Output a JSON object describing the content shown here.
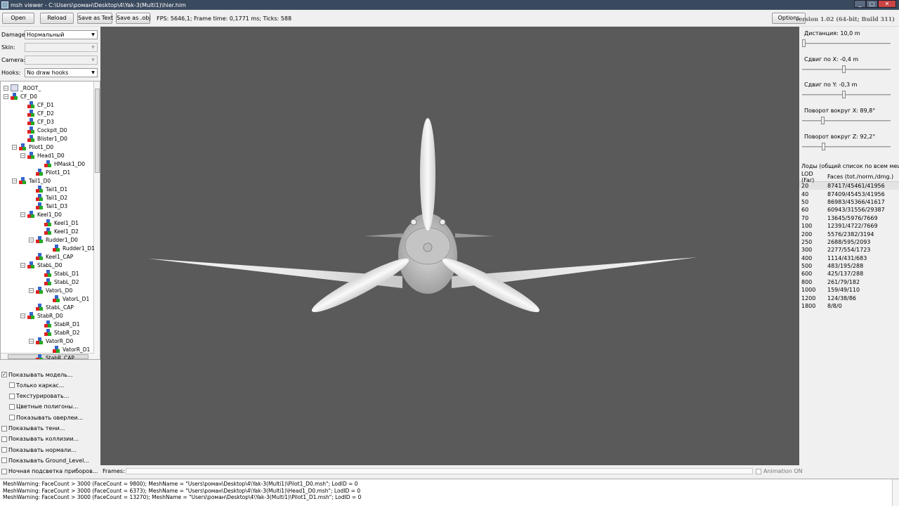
{
  "window": {
    "title": "msh viewer - C:\\Users\\роман\\Desktop\\4\\Yak-3(Multi1)\\hier.him",
    "minimize": "_",
    "maximize": "□",
    "close": "✕"
  },
  "toolbar": {
    "open": "Open",
    "reload": "Reload",
    "save_text": "Save as Text",
    "save_obj": "Save as .obj",
    "fps": "FPS: 5646,1; Frame time: 0,1771 ms; Ticks: 588",
    "options": "Options",
    "version": "version 1.02 (64-bit; Build 311)"
  },
  "controls": {
    "damage_label": "Damage:",
    "damage_value": "Нормальный",
    "skin_label": "Skin:",
    "skin_value": "",
    "camera_label": "Camera:",
    "camera_value": "",
    "hooks_label": "Hooks:",
    "hooks_value": "No draw hooks"
  },
  "tree": [
    {
      "label": "_ROOT_",
      "depth": 0,
      "box": "−",
      "root": true
    },
    {
      "label": "CF_D0",
      "depth": 1,
      "box": "−"
    },
    {
      "label": "CF_D1",
      "depth": 2,
      "box": ""
    },
    {
      "label": "CF_D2",
      "depth": 2,
      "box": ""
    },
    {
      "label": "CF_D3",
      "depth": 2,
      "box": ""
    },
    {
      "label": "Cockpit_D0",
      "depth": 2,
      "box": ""
    },
    {
      "label": "Blister1_D0",
      "depth": 2,
      "box": ""
    },
    {
      "label": "Pilot1_D0",
      "depth": 2,
      "box": "−",
      "boxDepth": 1
    },
    {
      "label": "Head1_D0",
      "depth": 3,
      "box": "−"
    },
    {
      "label": "HMask1_D0",
      "depth": 4,
      "box": ""
    },
    {
      "label": "Pilot1_D1",
      "depth": 3,
      "box": ""
    },
    {
      "label": "Tail1_D0",
      "depth": 2,
      "box": "−",
      "boxDepth": 1
    },
    {
      "label": "Tail1_D1",
      "depth": 3,
      "box": ""
    },
    {
      "label": "Tail1_D2",
      "depth": 3,
      "box": ""
    },
    {
      "label": "Tail1_D3",
      "depth": 3,
      "box": ""
    },
    {
      "label": "Keel1_D0",
      "depth": 3,
      "box": "−"
    },
    {
      "label": "Keel1_D1",
      "depth": 4,
      "box": ""
    },
    {
      "label": "Keel1_D2",
      "depth": 4,
      "box": ""
    },
    {
      "label": "Rudder1_D0",
      "depth": 4,
      "box": "−"
    },
    {
      "label": "Rudder1_D1",
      "depth": 5,
      "box": ""
    },
    {
      "label": "Keel1_CAP",
      "depth": 3,
      "box": ""
    },
    {
      "label": "StabL_D0",
      "depth": 3,
      "box": "−"
    },
    {
      "label": "StabL_D1",
      "depth": 4,
      "box": ""
    },
    {
      "label": "StabL_D2",
      "depth": 4,
      "box": ""
    },
    {
      "label": "VatorL_D0",
      "depth": 4,
      "box": "−"
    },
    {
      "label": "VatorL_D1",
      "depth": 5,
      "box": ""
    },
    {
      "label": "StabL_CAP",
      "depth": 3,
      "box": ""
    },
    {
      "label": "StabR_D0",
      "depth": 3,
      "box": "−"
    },
    {
      "label": "StabR_D1",
      "depth": 4,
      "box": ""
    },
    {
      "label": "StabR_D2",
      "depth": 4,
      "box": ""
    },
    {
      "label": "VatorR_D0",
      "depth": 4,
      "box": "−"
    },
    {
      "label": "VatorR_D1",
      "depth": 5,
      "box": ""
    },
    {
      "label": "StabR_CAP",
      "depth": 3,
      "box": ""
    }
  ],
  "options": [
    {
      "label": "Показывать модель...",
      "checked": true,
      "indent": false
    },
    {
      "label": "Только каркас...",
      "checked": false,
      "indent": true
    },
    {
      "label": "Текстурировать...",
      "checked": false,
      "indent": true
    },
    {
      "label": "Цветные полигоны...",
      "checked": false,
      "indent": true
    },
    {
      "label": "Показывать оверлеи...",
      "checked": false,
      "indent": true
    },
    {
      "label": "Показывать тени...",
      "checked": false,
      "indent": false
    },
    {
      "label": "Показывать коллизии...",
      "checked": false,
      "indent": false
    },
    {
      "label": "Показывать нормали...",
      "checked": false,
      "indent": false
    },
    {
      "label": "Показывать Ground_Level...",
      "checked": false,
      "indent": false
    },
    {
      "label": "Ночная подсветка приборов...",
      "checked": false,
      "indent": false
    }
  ],
  "frames": {
    "label": "Frames:",
    "animation": "Animation ON"
  },
  "sliders": [
    {
      "label": "Дистанция:",
      "value": "10,0 m",
      "fraction": 0.0
    },
    {
      "label": "Сдвиг по X:",
      "value": "-0,4 m",
      "fraction": 0.47
    },
    {
      "label": "Сдвиг по Y:",
      "value": "-0,3 m",
      "fraction": 0.47
    },
    {
      "label": "Поворот вокруг X:",
      "value": "89,8°",
      "fraction": 0.22
    },
    {
      "label": "Поворот вокруг Z:",
      "value": "92,2°",
      "fraction": 0.23
    }
  ],
  "lods": {
    "label": "Лоды (общий список по всем мешам):",
    "col1": "LOD (Far)",
    "col2": "Faces (tot./norm./dmg.)",
    "rows": [
      [
        "20",
        "87417/45461/41956"
      ],
      [
        "40",
        "87409/45453/41956"
      ],
      [
        "50",
        "86983/45366/41617"
      ],
      [
        "60",
        "60943/31556/29387"
      ],
      [
        "70",
        "13645/5976/7669"
      ],
      [
        "100",
        "12391/4722/7669"
      ],
      [
        "200",
        "5576/2382/3194"
      ],
      [
        "250",
        "2688/595/2093"
      ],
      [
        "300",
        "2277/554/1723"
      ],
      [
        "400",
        "1114/431/683"
      ],
      [
        "500",
        "483/195/288"
      ],
      [
        "600",
        "425/137/288"
      ],
      [
        "800",
        "261/79/182"
      ],
      [
        "1000",
        "159/49/110"
      ],
      [
        "1200",
        "124/38/86"
      ],
      [
        "1800",
        "8/8/0"
      ]
    ]
  },
  "log": [
    "MeshWarning: FaceCount > 3000 (FaceCount = 9800); MeshName = \"Users\\роман\\Desktop\\4\\Yak-3(Multi1)\\Pilot1_D0.msh\"; LodID = 0",
    "MeshWarning: FaceCount > 3000 (FaceCount = 6373); MeshName = \"Users\\роман\\Desktop\\4\\Yak-3(Multi1)\\Head1_D0.msh\"; LodID = 0",
    "MeshWarning: FaceCount > 3000 (FaceCount = 13270); MeshName = \"Users\\роман\\Desktop\\4\\Yak-3(Multi1)\\Pilot1_D1.msh\"; LodID = 0"
  ]
}
